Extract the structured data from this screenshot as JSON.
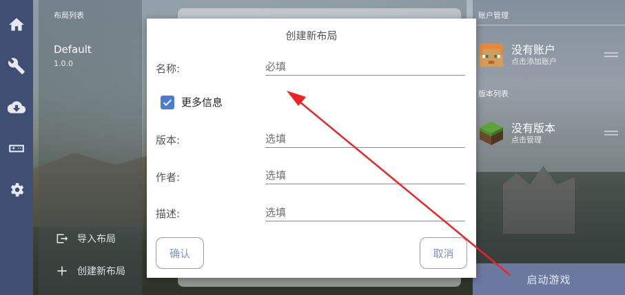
{
  "nav_rail": {
    "items": [
      {
        "icon": "home-icon"
      },
      {
        "icon": "wrench-icon"
      },
      {
        "icon": "cloud-download-icon"
      },
      {
        "icon": "controller-icon"
      },
      {
        "icon": "gear-icon"
      }
    ]
  },
  "left_panel": {
    "header": "布局列表",
    "layouts": [
      {
        "name": "Default",
        "version": "1.0.0"
      }
    ],
    "import_label": "导入布局",
    "create_label": "创建新布局"
  },
  "right_panel": {
    "account_header": "账户管理",
    "account_title": "没有账户",
    "account_sub": "点击添加账户",
    "version_header": "版本列表",
    "version_title": "没有版本",
    "version_sub": "点击管理",
    "launch_label": "启动游戏"
  },
  "dialog": {
    "title": "创建新布局",
    "name_label": "名称:",
    "name_placeholder": "必填",
    "more_info_label": "更多信息",
    "more_info_checked": true,
    "version_label": "版本:",
    "version_placeholder": "选填",
    "author_label": "作者:",
    "author_placeholder": "选填",
    "desc_label": "描述:",
    "desc_placeholder": "选填",
    "confirm_label": "确认",
    "cancel_label": "取消"
  },
  "colors": {
    "rail": "#3f4e73",
    "accent": "#4c7bd4",
    "button_text": "#7f95c7",
    "annotation_arrow": "#ee2222"
  }
}
